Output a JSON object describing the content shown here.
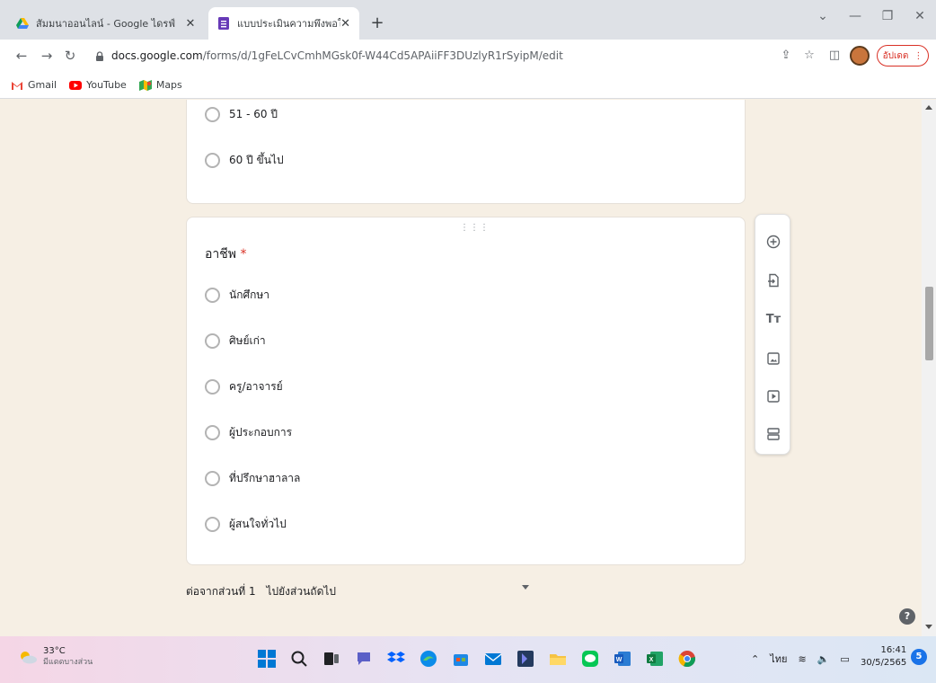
{
  "browser": {
    "tabs": [
      {
        "title": "สัมมนาออนไลน์ - Google ไดรฟ์",
        "active": false
      },
      {
        "title": "แบบประเมินความพึงพอใจต่อการสัมมนา",
        "active": true
      }
    ],
    "url_host": "docs.google.com",
    "url_path": "/forms/d/1gFeLCvCmhMGsk0f-W44Cd5APAiiFF3DUzlyR1rSyipM/edit",
    "update_label": "อัปเดต",
    "bookmarks": [
      "Gmail",
      "YouTube",
      "Maps"
    ]
  },
  "form": {
    "prev_options": [
      "51 - 60 ปี",
      "60 ปี ขึ้นไป"
    ],
    "question": {
      "title": "อาชีพ",
      "required_mark": "*",
      "options": [
        "นักศึกษา",
        "ศิษย์เก่า",
        "ครู/อาจารย์",
        "ผู้ประกอบการ",
        "ที่ปรึกษาฮาลาล",
        "ผู้สนใจทั่วไป"
      ]
    },
    "after_section_label": "ต่อจากส่วนที่ 1",
    "after_section_value": "ไปยังส่วนถัดไป"
  },
  "taskbar": {
    "temperature": "33°C",
    "weather_desc": "มีแดดบางส่วน",
    "language": "ไทย",
    "time": "16:41",
    "date": "30/5/2565",
    "notification_count": "5"
  },
  "colors": {
    "page_bg": "#f6efe4",
    "required": "#d93025",
    "accent": "#673ab7"
  }
}
